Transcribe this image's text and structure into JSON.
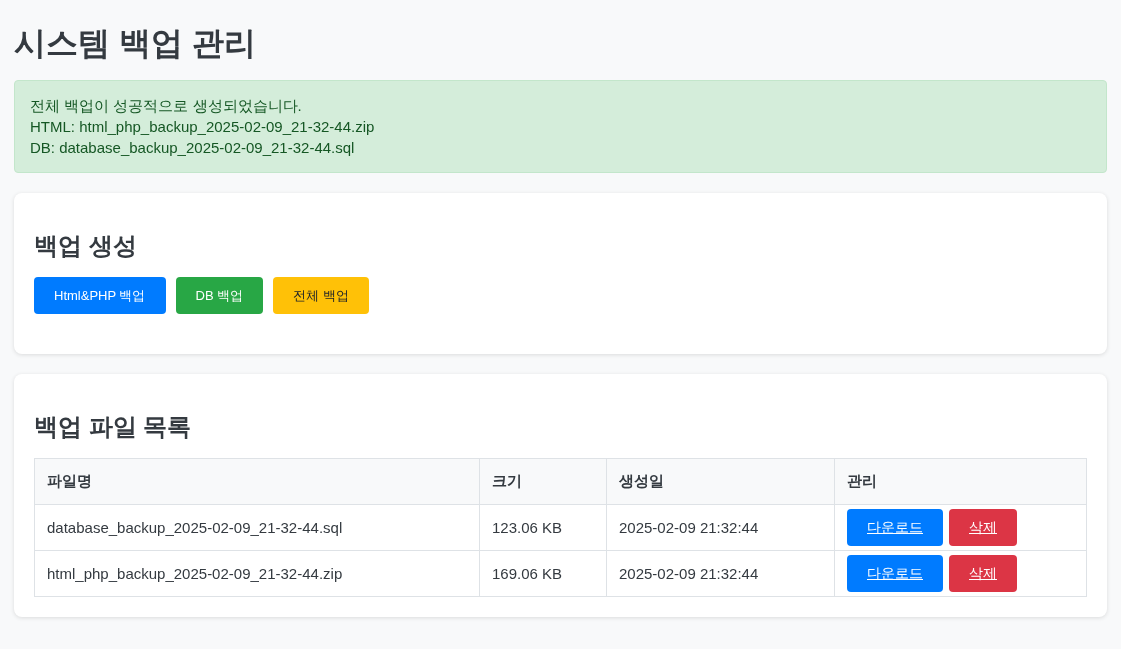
{
  "title": "시스템 백업 관리",
  "alert": {
    "lines": [
      "전체 백업이 성공적으로 생성되었습니다.",
      "HTML: html_php_backup_2025-02-09_21-32-44.zip",
      "DB: database_backup_2025-02-09_21-32-44.sql"
    ]
  },
  "create_section": {
    "heading": "백업 생성",
    "buttons": [
      {
        "label": "Html&PHP 백업",
        "kind": "primary"
      },
      {
        "label": "DB 백업",
        "kind": "success"
      },
      {
        "label": "전체 백업",
        "kind": "warning"
      }
    ]
  },
  "list_section": {
    "heading": "백업 파일 목록",
    "columns": [
      "파일명",
      "크기",
      "생성일",
      "관리"
    ],
    "rows": [
      {
        "name": "database_backup_2025-02-09_21-32-44.sql",
        "size": "123.06 KB",
        "created": "2025-02-09 21:32:44",
        "actions": [
          {
            "label": "다운로드",
            "kind": "primary"
          },
          {
            "label": "삭제",
            "kind": "danger"
          }
        ]
      },
      {
        "name": "html_php_backup_2025-02-09_21-32-44.zip",
        "size": "169.06 KB",
        "created": "2025-02-09 21:32:44",
        "actions": [
          {
            "label": "다운로드",
            "kind": "primary"
          },
          {
            "label": "삭제",
            "kind": "danger"
          }
        ]
      }
    ]
  }
}
